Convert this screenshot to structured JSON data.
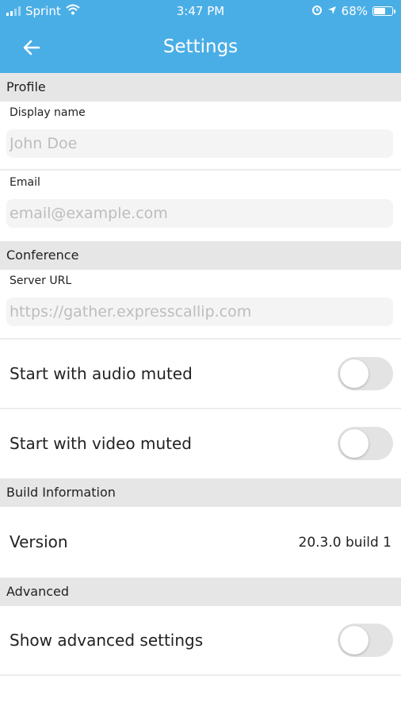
{
  "status_bar": {
    "carrier": "Sprint",
    "time": "3:47 PM",
    "battery": "68%",
    "battery_level": 0.68,
    "icons": [
      "signal-bars-icon",
      "wifi-icon",
      "alarm-icon",
      "location-arrow-icon",
      "battery-icon"
    ]
  },
  "header": {
    "title": "Settings",
    "back_icon": "arrow-left-icon",
    "background": "#4aaee6"
  },
  "profile": {
    "section_title": "Profile",
    "display_name_label": "Display name",
    "display_name_placeholder": "John Doe",
    "email_label": "Email",
    "email_placeholder": "email@example.com"
  },
  "conference": {
    "section_title": "Conference",
    "server_url_label": "Server URL",
    "server_url_placeholder": "https://gather.expresscallip.com",
    "audio_muted_label": "Start with audio muted",
    "audio_muted": false,
    "video_muted_label": "Start with video muted",
    "video_muted": false
  },
  "build_info": {
    "section_title": "Build Information",
    "version_label": "Version",
    "version_value": "20.3.0 build 1"
  },
  "advanced": {
    "section_title": "Advanced",
    "show_advanced_label": "Show advanced settings",
    "show_advanced": false
  }
}
